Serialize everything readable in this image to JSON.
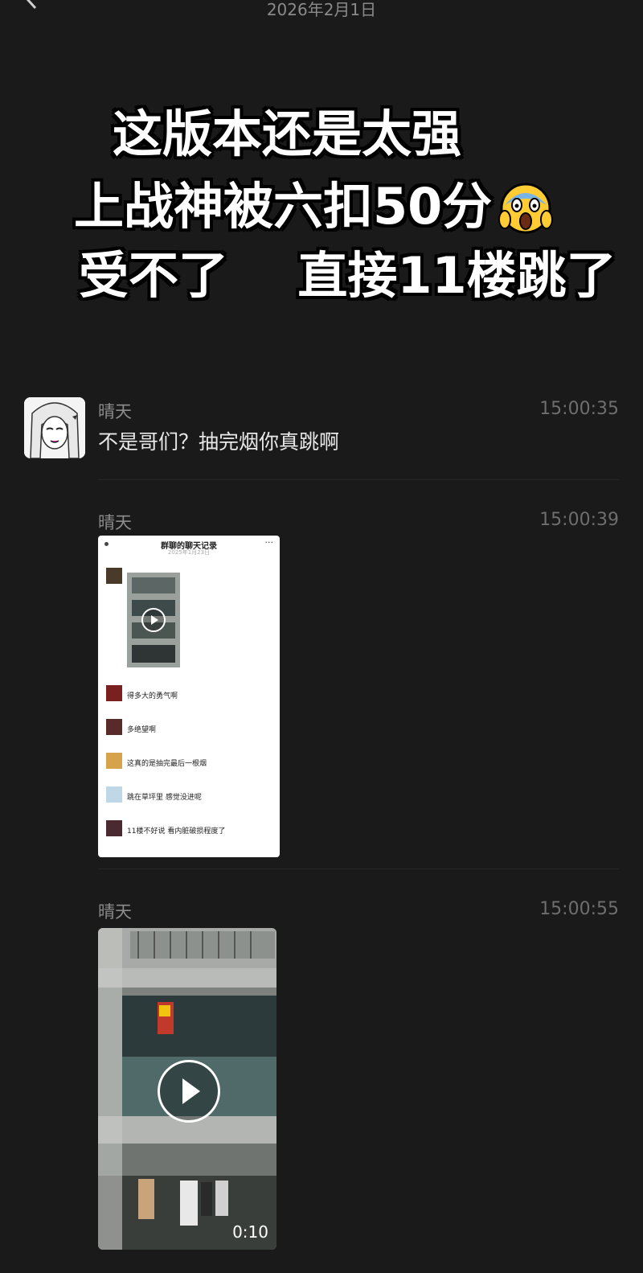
{
  "header": {
    "date": "2026年2月1日"
  },
  "overlay": {
    "line1": "这版本还是太强",
    "line2": "上战神被六扣50分",
    "emoji": "face-screaming-in-fear",
    "line3": "受不了    直接11楼跳了"
  },
  "messages": [
    {
      "sender": "晴天",
      "time": "15:00:35",
      "text": "不是哥们？抽完烟你真跳啊"
    },
    {
      "sender": "晴天",
      "time": "15:00:39",
      "screenshot": {
        "title": "群聊的聊天记录",
        "subtitle": "2025年1月23日",
        "menu": "···",
        "rows": [
          {
            "text": "得多大的勇气啊"
          },
          {
            "text": "多绝望啊"
          },
          {
            "text": "这真的是抽完最后一根烟"
          },
          {
            "text": "跳在草坪里 感觉没进呢"
          },
          {
            "text": "11楼不好说 看内脏破损程度了"
          }
        ]
      }
    },
    {
      "sender": "晴天",
      "time": "15:00:55",
      "video": {
        "duration": "0:10"
      }
    }
  ]
}
